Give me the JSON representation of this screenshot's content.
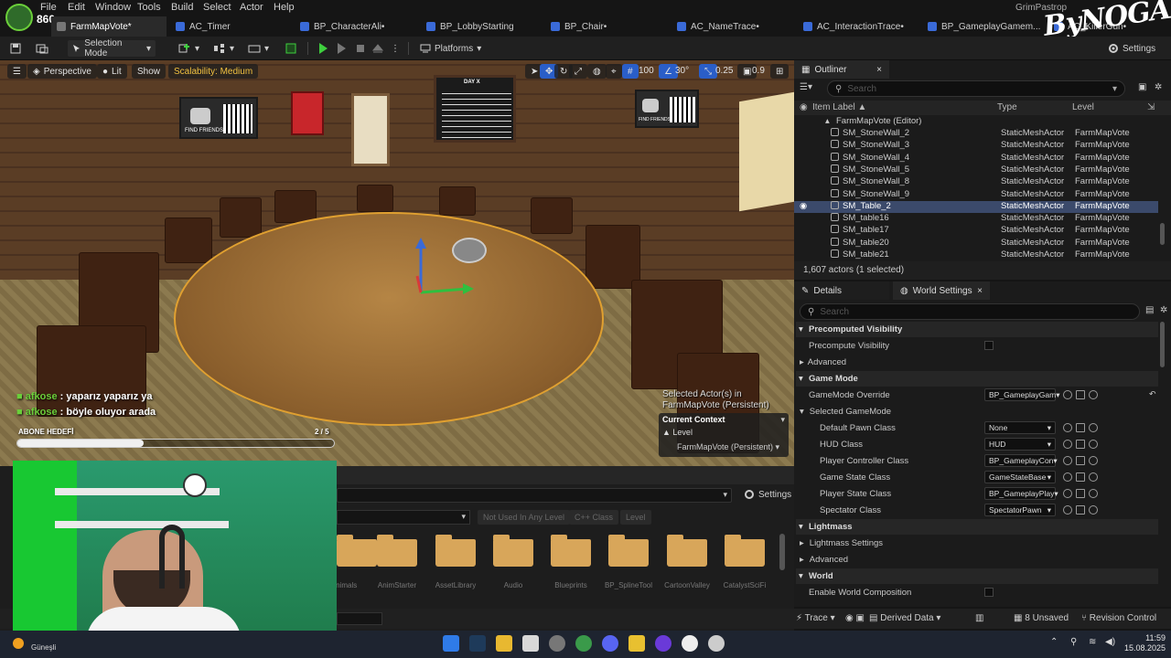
{
  "menu": {
    "level": "860",
    "items": [
      "File",
      "Edit",
      "Window",
      "Tools",
      "Build",
      "Select",
      "Actor",
      "Help"
    ]
  },
  "tabs": [
    {
      "label": "FarmMapVote*"
    },
    {
      "label": "AC_Timer"
    },
    {
      "label": "BP_CharacterAli•"
    },
    {
      "label": "BP_LobbyStarting"
    },
    {
      "label": "BP_Chair•"
    },
    {
      "label": "AC_NameTrace•"
    },
    {
      "label": "AC_InteractionTrace•"
    },
    {
      "label": "BP_GameplayGamem..."
    },
    {
      "label": "AC_KillerGun•"
    }
  ],
  "brand": {
    "account": "GrimPastrop",
    "logo": "ByNOGAM"
  },
  "toolbar": {
    "selection_mode": "Selection Mode",
    "platforms": "Platforms",
    "settings": "Settings"
  },
  "viewport": {
    "perspective": "Perspective",
    "lit": "Lit",
    "show": "Show",
    "scalability": "Scalability: Medium",
    "grid_snap": "100",
    "angle_snap": "30°",
    "scale_snap": "0.25",
    "camera_speed": "0.9",
    "posters": {
      "poster1": "FIND FRIENDS",
      "poster2": "FIND FRIENDS",
      "board_title": "DAY X"
    },
    "chat": [
      {
        "name": "afkose",
        "text": ": yaparız yaparız ya"
      },
      {
        "name": "afkose",
        "text": ": böyle oluyor arada"
      }
    ],
    "goal_label": "ABONE HEDEFİ",
    "goal_count": "2 / 5",
    "goal_progress": 0.4,
    "selected_info": "Selected Actor(s) in",
    "selected_level": "FarmMapVote (Persistent)",
    "current_context": "Current Context",
    "level_label": "Level",
    "level_value": "FarmMapVote (Persistent)"
  },
  "content_browser": {
    "settings": "Settings",
    "filters": [
      "Not Used In Any Level",
      "C++ Class",
      "Level"
    ],
    "folders": [
      "Animals",
      "AnimStarter",
      "AssetLibrary",
      "Audio",
      "Blueprints",
      "BP_SplineTool",
      "CartoonValley",
      "CatalystSciFi"
    ]
  },
  "outliner": {
    "title": "Outliner",
    "search_placeholder": "Search",
    "columns": {
      "label": "Item Label",
      "type": "Type",
      "level": "Level"
    },
    "root": "FarmMapVote (Editor)",
    "rows": [
      {
        "label": "SM_StoneWall_2",
        "type": "StaticMeshActor",
        "level": "FarmMapVote",
        "selected": false
      },
      {
        "label": "SM_StoneWall_3",
        "type": "StaticMeshActor",
        "level": "FarmMapVote",
        "selected": false
      },
      {
        "label": "SM_StoneWall_4",
        "type": "StaticMeshActor",
        "level": "FarmMapVote",
        "selected": false
      },
      {
        "label": "SM_StoneWall_5",
        "type": "StaticMeshActor",
        "level": "FarmMapVote",
        "selected": false
      },
      {
        "label": "SM_StoneWall_8",
        "type": "StaticMeshActor",
        "level": "FarmMapVote",
        "selected": false
      },
      {
        "label": "SM_StoneWall_9",
        "type": "StaticMeshActor",
        "level": "FarmMapVote",
        "selected": false
      },
      {
        "label": "SM_Table_2",
        "type": "StaticMeshActor",
        "level": "FarmMapVote",
        "selected": true
      },
      {
        "label": "SM_table16",
        "type": "StaticMeshActor",
        "level": "FarmMapVote",
        "selected": false
      },
      {
        "label": "SM_table17",
        "type": "StaticMeshActor",
        "level": "FarmMapVote",
        "selected": false
      },
      {
        "label": "SM_table20",
        "type": "StaticMeshActor",
        "level": "FarmMapVote",
        "selected": false
      },
      {
        "label": "SM_table21",
        "type": "StaticMeshActor",
        "level": "FarmMapVote",
        "selected": false
      }
    ],
    "footer": "1,607 actors (1 selected)"
  },
  "details": {
    "tab_details": "Details",
    "tab_world": "World Settings",
    "search_placeholder": "Search",
    "sections": {
      "precomputed": "Precomputed Visibility",
      "precompute_visibility": "Precompute Visibility",
      "advanced1": "Advanced",
      "game_mode": "Game Mode",
      "gamemode_override": "GameMode Override",
      "gamemode_override_value": "BP_GameplayGam",
      "selected_game_mode": "Selected GameMode",
      "lightmass": "Lightmass",
      "lightmass_settings": "Lightmass Settings",
      "advanced2": "Advanced",
      "world": "World",
      "enable_world_composition": "Enable World Composition"
    },
    "props": [
      {
        "label": "Default Pawn Class",
        "value": "None"
      },
      {
        "label": "HUD Class",
        "value": "HUD"
      },
      {
        "label": "Player Controller Class",
        "value": "BP_GameplayCon"
      },
      {
        "label": "Game State Class",
        "value": "GameStateBase"
      },
      {
        "label": "Player State Class",
        "value": "BP_GameplayPlay"
      },
      {
        "label": "Spectator Class",
        "value": "SpectatorPawn"
      }
    ]
  },
  "statusbar": {
    "trace": "Trace",
    "derived_data": "Derived Data",
    "unsaved": "8 Unsaved",
    "revision_control": "Revision Control"
  },
  "taskbar": {
    "weather": "Güneşli",
    "time": "11:59",
    "date": "15.08.2025"
  }
}
